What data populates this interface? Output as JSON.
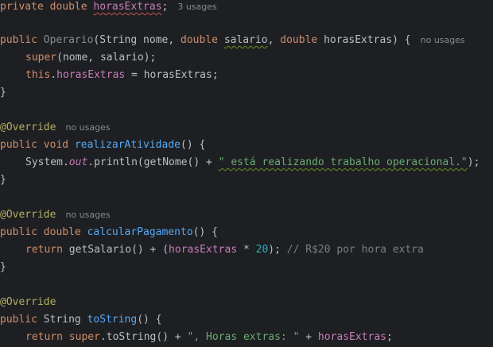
{
  "tokens": {
    "private": "private",
    "double": "double",
    "public": "public",
    "void": "void",
    "return": "return",
    "super": "super",
    "this": "this",
    "string_type": "String",
    "override": "@Override"
  },
  "code": {
    "field_name": "horasExtras",
    "semicolon": ";",
    "class_name": "Operario",
    "param_nome": "nome",
    "param_salario": "salario",
    "param_horas": "horasExtras",
    "m1_name": "realizarAtividade",
    "system": "System",
    "out": "out",
    "println": "println",
    "getNome": "getNome",
    "str1": "\" está realizando trabalho operacional.\"",
    "m2_name": "calcularPagamento",
    "getSalario": "getSalario",
    "num20": "20",
    "comment": "// R$20 por hora extra",
    "m3_name": "toString",
    "str2": "\", Horas extras: \""
  },
  "usages": {
    "field": "3 usages",
    "constructor": "no usages",
    "realizar": "no usages",
    "calcular": "no usages"
  }
}
